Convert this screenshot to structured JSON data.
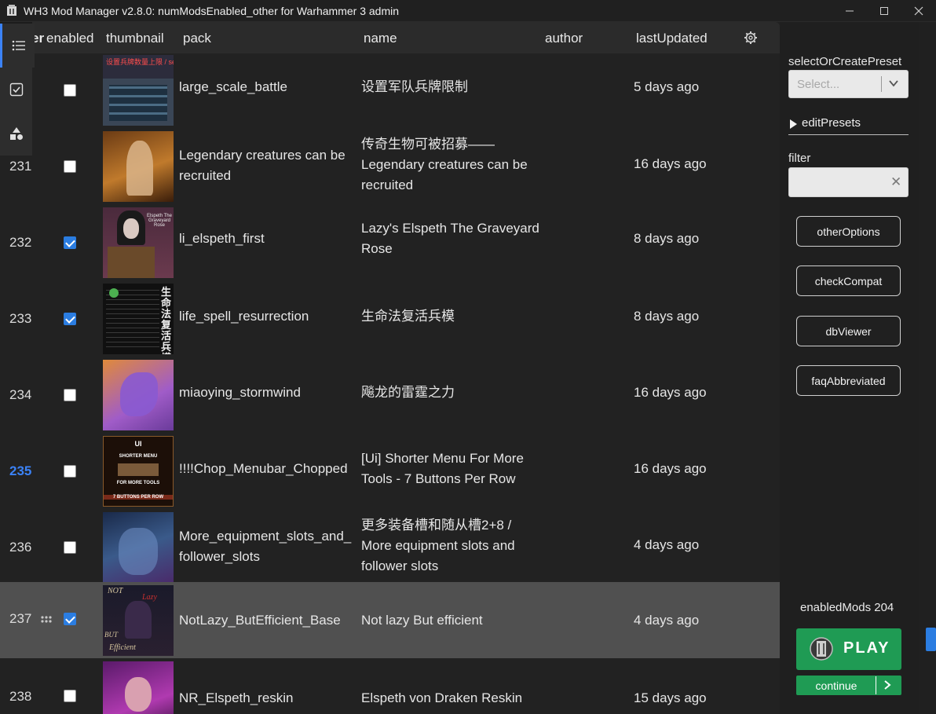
{
  "window": {
    "title": "WH3 Mod Manager v2.8.0: numModsEnabled_other for Warhammer 3 admin",
    "icon": "app-icon",
    "controls": [
      "minimize-icon",
      "maximize-icon",
      "close-icon"
    ]
  },
  "rail": {
    "items": [
      {
        "icon": "list-icon"
      },
      {
        "icon": "checkbox-icon"
      },
      {
        "icon": "shapes-icon"
      }
    ]
  },
  "table": {
    "columns": {
      "order": "er",
      "enabled": "enabled",
      "thumbnail": "thumbnail",
      "pack": "pack",
      "name": "name",
      "author": "author",
      "lastUpdated": "lastUpdated"
    },
    "settings_icon": "gear-icon",
    "rows": [
      {
        "num": "",
        "enabled": false,
        "pack": "large_scale_battle",
        "name": "设置军队兵牌限制",
        "author": "",
        "updated": "5 days ago",
        "thumb_text": "设置兵牌数量上限 / set army unit card limit"
      },
      {
        "num": "231",
        "enabled": false,
        "pack": "Legendary creatures can be recruited",
        "name": "传奇生物可被招募—— Legendary creatures can be recruited",
        "author": "",
        "updated": "16 days ago"
      },
      {
        "num": "232",
        "enabled": true,
        "pack": "li_elspeth_first",
        "name": "Lazy's Elspeth The Graveyard Rose",
        "author": "",
        "updated": "8 days ago",
        "thumb_text": "Elspeth The Graveyard Rose"
      },
      {
        "num": "233",
        "enabled": true,
        "pack": "life_spell_resurrection",
        "name": "生命法复活兵模",
        "author": "",
        "updated": "8 days ago",
        "thumb_text": "生命法复活兵模"
      },
      {
        "num": "234",
        "enabled": false,
        "pack": "miaoying_stormwind",
        "name": "飚龙的雷霆之力",
        "author": "",
        "updated": "16 days ago"
      },
      {
        "num": "235",
        "enabled": false,
        "pack": "!!!!Chop_Menubar_Chopped",
        "name": "[Ui] Shorter Menu For More Tools - 7 Buttons Per Row",
        "author": "",
        "updated": "16 days ago",
        "highlight": true,
        "thumb_text": [
          "UI",
          "SHORTER MENU",
          "FOR MORE TOOLS",
          "7 BUTTONS PER ROW"
        ]
      },
      {
        "num": "236",
        "enabled": false,
        "pack": "More_equipment_slots_and_follower_slots",
        "name": "更多装备槽和随从槽2+8 / More equipment slots and follower slots",
        "author": "",
        "updated": "4 days ago"
      },
      {
        "num": "237",
        "enabled": true,
        "pack": "NotLazy_ButEfficient_Base",
        "name": "Not lazy But efficient",
        "author": "",
        "updated": "4 days ago",
        "selected": true,
        "thumb_text": [
          "NOT",
          "Lazy",
          "BUT",
          "Efficient"
        ]
      },
      {
        "num": "238",
        "enabled": false,
        "pack": "NR_Elspeth_reskin",
        "name": "Elspeth von Draken Reskin",
        "author": "",
        "updated": "15 days ago"
      }
    ]
  },
  "sidebar": {
    "preset_label": "selectOrCreatePreset",
    "preset_placeholder": "Select...",
    "edit_presets": "editPresets",
    "filter_label": "filter",
    "filter_value": "",
    "buttons": [
      "otherOptions",
      "checkCompat",
      "dbViewer",
      "faqAbbreviated"
    ],
    "enabled_mods": "enabledMods 204",
    "play": "PLAY",
    "continue": "continue"
  },
  "colors": {
    "accent": "#3b82f6",
    "play_green": "#1f9b54",
    "checkbox_on": "#2b7de1",
    "selected_row": "#505050"
  }
}
